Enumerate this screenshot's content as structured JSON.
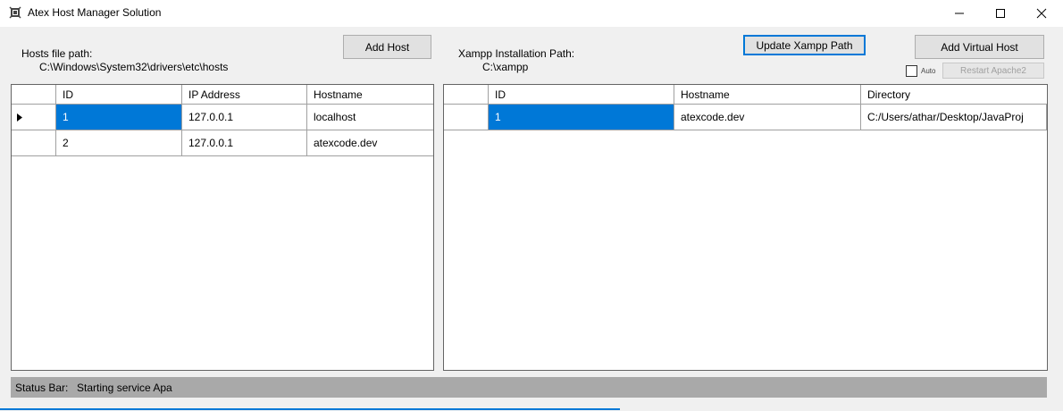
{
  "window": {
    "title": "Atex Host Manager Solution"
  },
  "hosts": {
    "path_label": "Hosts file path:",
    "path_value": "C:\\Windows\\System32\\drivers\\etc\\hosts",
    "add_button": "Add Host",
    "columns": [
      "ID",
      "IP Address",
      "Hostname"
    ],
    "rows": [
      {
        "id": "1",
        "ip": "127.0.0.1",
        "hostname": "localhost"
      },
      {
        "id": "2",
        "ip": "127.0.0.1",
        "hostname": "atexcode.dev"
      }
    ]
  },
  "xampp": {
    "path_label": "Xampp Installation Path:",
    "path_value": "C:\\xampp",
    "update_button": "Update Xampp Path",
    "add_vhost_button": "Add Virtual Host",
    "auto_label": "Auto",
    "restart_button": "Restart Apache2",
    "columns": [
      "ID",
      "Hostname",
      "Directory"
    ],
    "rows": [
      {
        "id": "1",
        "hostname": "atexcode.dev",
        "directory": "C:/Users/athar/Desktop/JavaProj"
      }
    ]
  },
  "status": {
    "label": "Status Bar:",
    "text": "Starting service Apa"
  },
  "colors": {
    "selection": "#0078d7",
    "status_bar": "#a9a9a9",
    "background": "#f0f0f0"
  }
}
